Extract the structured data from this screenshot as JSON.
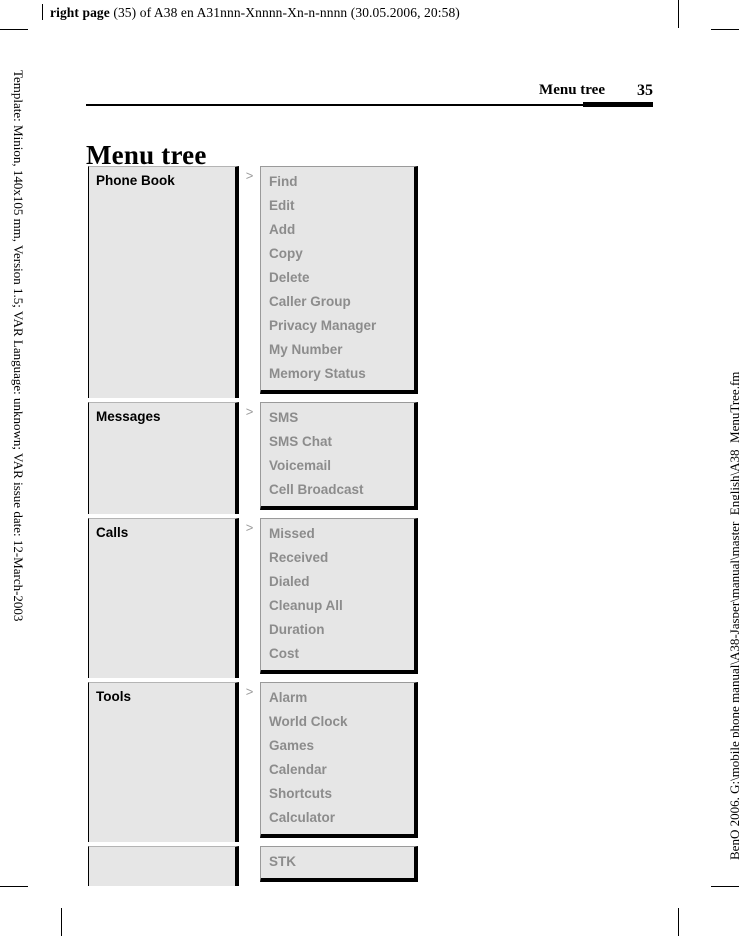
{
  "slug": {
    "bold_prefix": "right page",
    "rest": " (35) of A38 en A31nnn-Xnnnn-Xn-n-nnnn (30.05.2006, 20:58)"
  },
  "margins": {
    "left_note": "Template: Minion, 140x105 mm, Version 1.5; VAR Language: unknown; VAR issue date: 12-March-2003",
    "right_note": "BenQ 2006, G:\\mobile phone manual\\A38-Jasper\\manual\\master_English\\A38_MenuTree.fm"
  },
  "header": {
    "title": "Menu tree",
    "page_number": "35"
  },
  "chapter": {
    "title": "Menu tree"
  },
  "colors": {
    "cell_background": "#e6e6e6",
    "child_text": "#8c8c8c",
    "parent_text": "#000000",
    "border_shadow": "#000000",
    "arrow": "#9a9a9a"
  },
  "tree": {
    "arrow_glyph": ">",
    "groups": [
      {
        "parent": "Phone Book",
        "children": [
          "Find",
          "Edit",
          "Add",
          "Copy",
          "Delete",
          "Caller Group",
          "Privacy Manager",
          "My Number",
          "Memory Status"
        ]
      },
      {
        "parent": "Messages",
        "children": [
          "SMS",
          "SMS Chat",
          "Voicemail",
          "Cell Broadcast"
        ]
      },
      {
        "parent": "Calls",
        "children": [
          "Missed",
          "Received",
          "Dialed",
          "Cleanup All",
          "Duration",
          "Cost"
        ]
      },
      {
        "parent": "Tools",
        "children": [
          "Alarm",
          "World Clock",
          "Games",
          "Calendar",
          "Shortcuts",
          "Calculator"
        ]
      },
      {
        "parent": "",
        "children": [
          "STK"
        ]
      }
    ]
  }
}
